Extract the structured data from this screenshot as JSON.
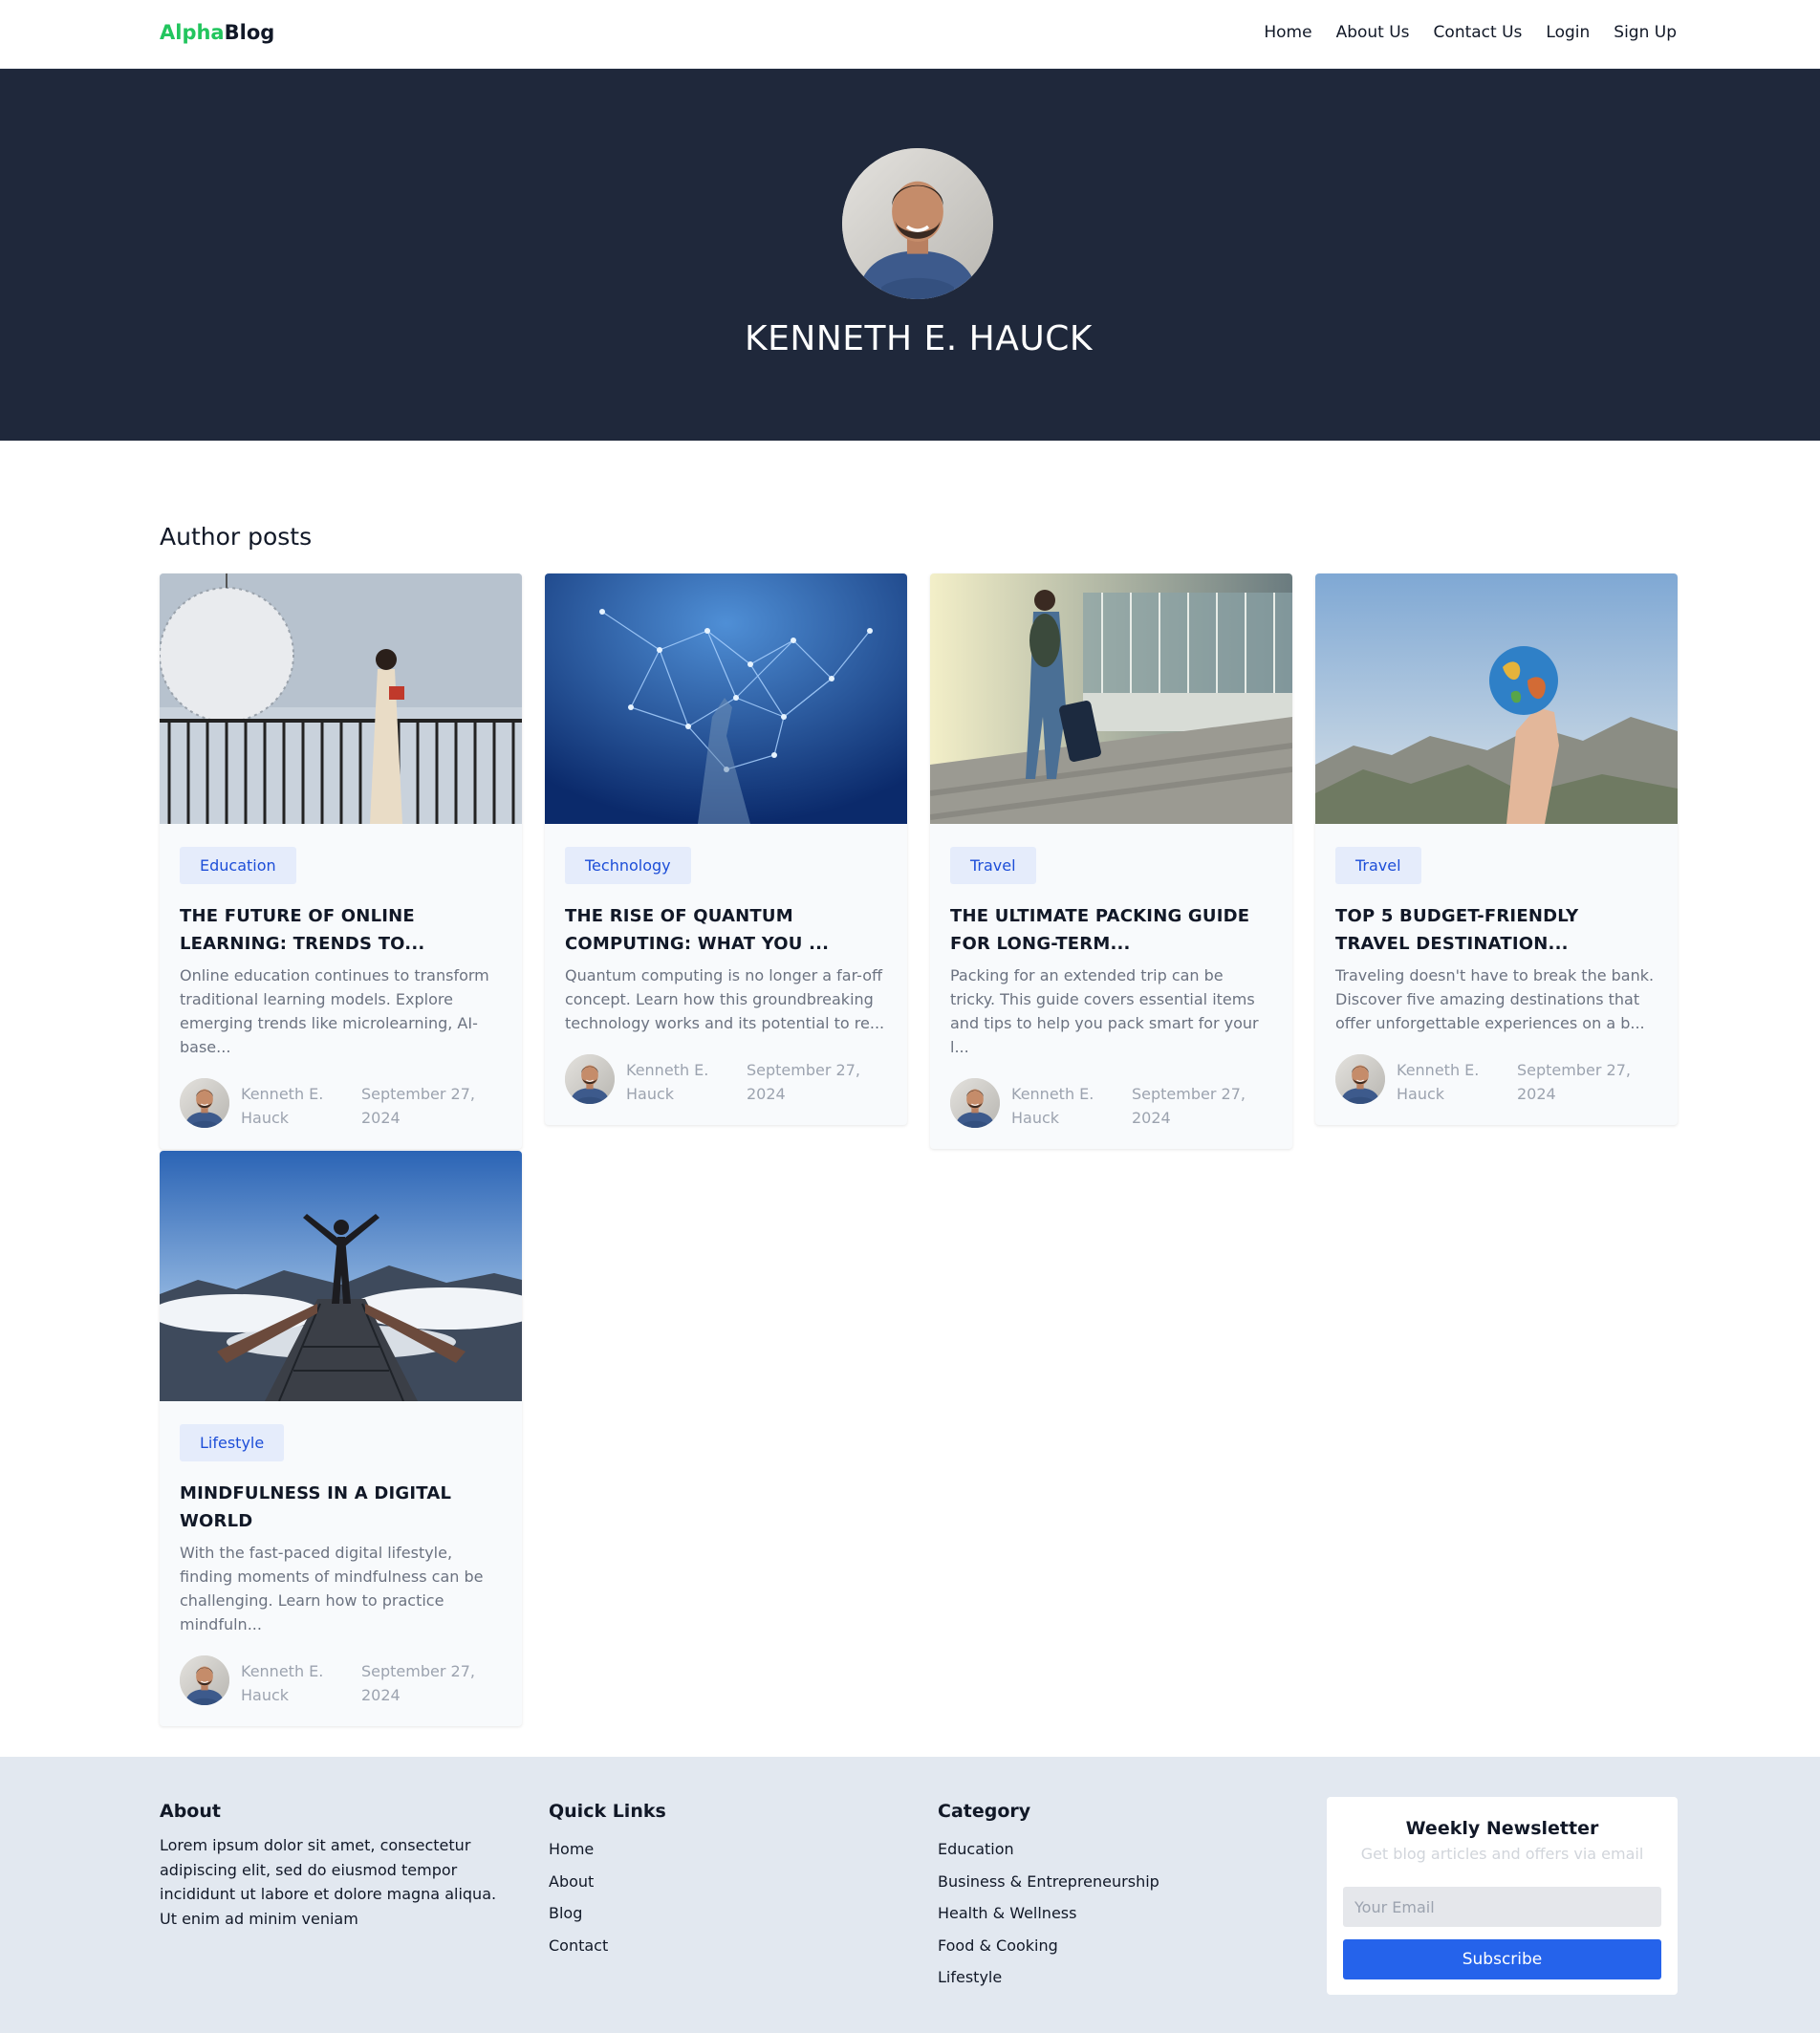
{
  "brand": {
    "part1": "Alpha",
    "part2": "Blog",
    "accent_color": "#22c55e"
  },
  "nav": [
    "Home",
    "About Us",
    "Contact Us",
    "Login",
    "Sign Up"
  ],
  "hero": {
    "name": "KENNETH E. HAUCK",
    "background": "#1f283b"
  },
  "section_title": "Author posts",
  "posts": [
    {
      "category": "Education",
      "title": "THE FUTURE OF ONLINE LEARNING: TRENDS TO...",
      "excerpt": "Online education continues to transform traditional learning models. Explore emerging trends like microlearning, AI-base...",
      "author": "Kenneth E. Hauck",
      "date": "September 27, 2024"
    },
    {
      "category": "Technology",
      "title": "THE RISE OF QUANTUM COMPUTING: WHAT YOU ...",
      "excerpt": "Quantum computing is no longer a far-off concept. Learn how this groundbreaking technology works and its potential to re...",
      "author": "Kenneth E. Hauck",
      "date": "September 27, 2024"
    },
    {
      "category": "Travel",
      "title": "THE ULTIMATE PACKING GUIDE FOR LONG-TERM...",
      "excerpt": "Packing for an extended trip can be tricky. This guide covers essential items and tips to help you pack smart for your l...",
      "author": "Kenneth E. Hauck",
      "date": "September 27, 2024"
    },
    {
      "category": "Travel",
      "title": "TOP 5 BUDGET-FRIENDLY TRAVEL DESTINATION...",
      "excerpt": "Traveling doesn't have to break the bank. Discover five amazing destinations that offer unforgettable experiences on a b...",
      "author": "Kenneth E. Hauck",
      "date": "September 27, 2024"
    },
    {
      "category": "Lifestyle",
      "title": "MINDFULNESS IN A DIGITAL WORLD",
      "excerpt": "With the fast-paced digital lifestyle, finding moments of mindfulness can be challenging. Learn how to practice mindfuln...",
      "author": "Kenneth E. Hauck",
      "date": "September 27, 2024"
    }
  ],
  "footer": {
    "about": {
      "heading": "About",
      "text": "Lorem ipsum dolor sit amet, consectetur adipiscing elit, sed do eiusmod tempor incididunt ut labore et dolore magna aliqua. Ut enim ad minim veniam"
    },
    "quick_links": {
      "heading": "Quick Links",
      "items": [
        "Home",
        "About",
        "Blog",
        "Contact"
      ]
    },
    "category": {
      "heading": "Category",
      "items": [
        "Education",
        "Business & Entrepreneurship",
        "Health & Wellness",
        "Food & Cooking",
        "Lifestyle"
      ]
    },
    "newsletter": {
      "heading": "Weekly Newsletter",
      "subtext": "Get blog articles and offers via email",
      "placeholder": "Your Email",
      "button": "Subscribe",
      "button_color": "#2563eb"
    }
  }
}
